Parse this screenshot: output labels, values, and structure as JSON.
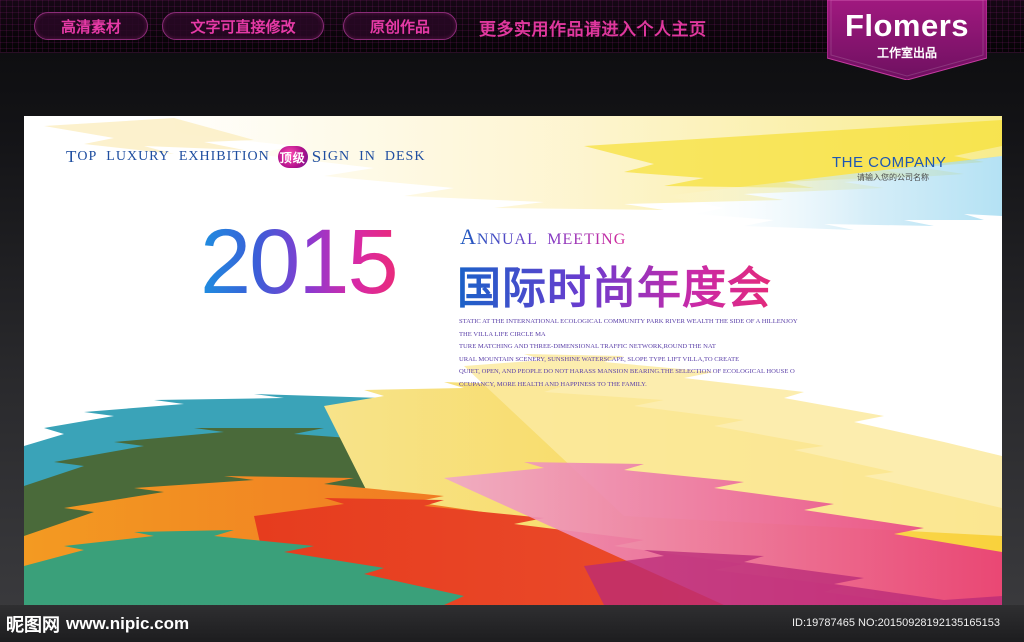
{
  "topbar": {
    "pills": [
      "高清素材",
      "文字可直接修改",
      "原创作品"
    ],
    "headline": "更多实用作品请进入个人主页",
    "brand": {
      "name": "Flomers",
      "sub": "工作室出品"
    }
  },
  "banner": {
    "tagline": {
      "top_cap": "T",
      "top_rest": "OP",
      "luxury": "LUXURY",
      "exhibition": "EXHIBITION",
      "badge": "顶级",
      "sign_cap": "S",
      "sign_rest": "IGN",
      "in": "IN",
      "desk": "DESK"
    },
    "company": "THE COMPANY",
    "company_sub": "请输入您的公司名称",
    "year": "2015",
    "annual_cap": "A",
    "annual_rest": "NNUAL  MEETING",
    "title_cn": "国际时尚年度会",
    "paragraph": [
      "STATIC AT THE INTERNATIONAL ECOLOGICAL COMMUNITY PARK RIVER WEALTH THE SIDE OF A HILLENJOY",
      "THE VILLA LIFE CIRCLE MA",
      "TURE MATCHING AND THREE-DIMENSIONAL TRAFFIC NETWORK,ROUND THE NAT",
      "URAL MOUNTAIN SCENERY, SUNSHINE WATERSCAPE, SLOPE TYPE LIFT VILLA,TO CREATE",
      "QUIET, OPEN, AND PEOPLE DO NOT HARASS MANSION BEARING.THE SELECTION OF ECOLOGICAL HOUSE O",
      "CCUPANCY, MORE HEALTH AND HAPPINESS TO THE FAMILY."
    ]
  },
  "watermark": {
    "logo": "昵图网",
    "site": "www.nipic.com",
    "id_text": "ID:19787465 NO:20150928192135165153"
  },
  "colors": {
    "accent_pink": "#e0389e",
    "blue": "#1e5bc0",
    "badge_magenta": "#8a1670"
  }
}
